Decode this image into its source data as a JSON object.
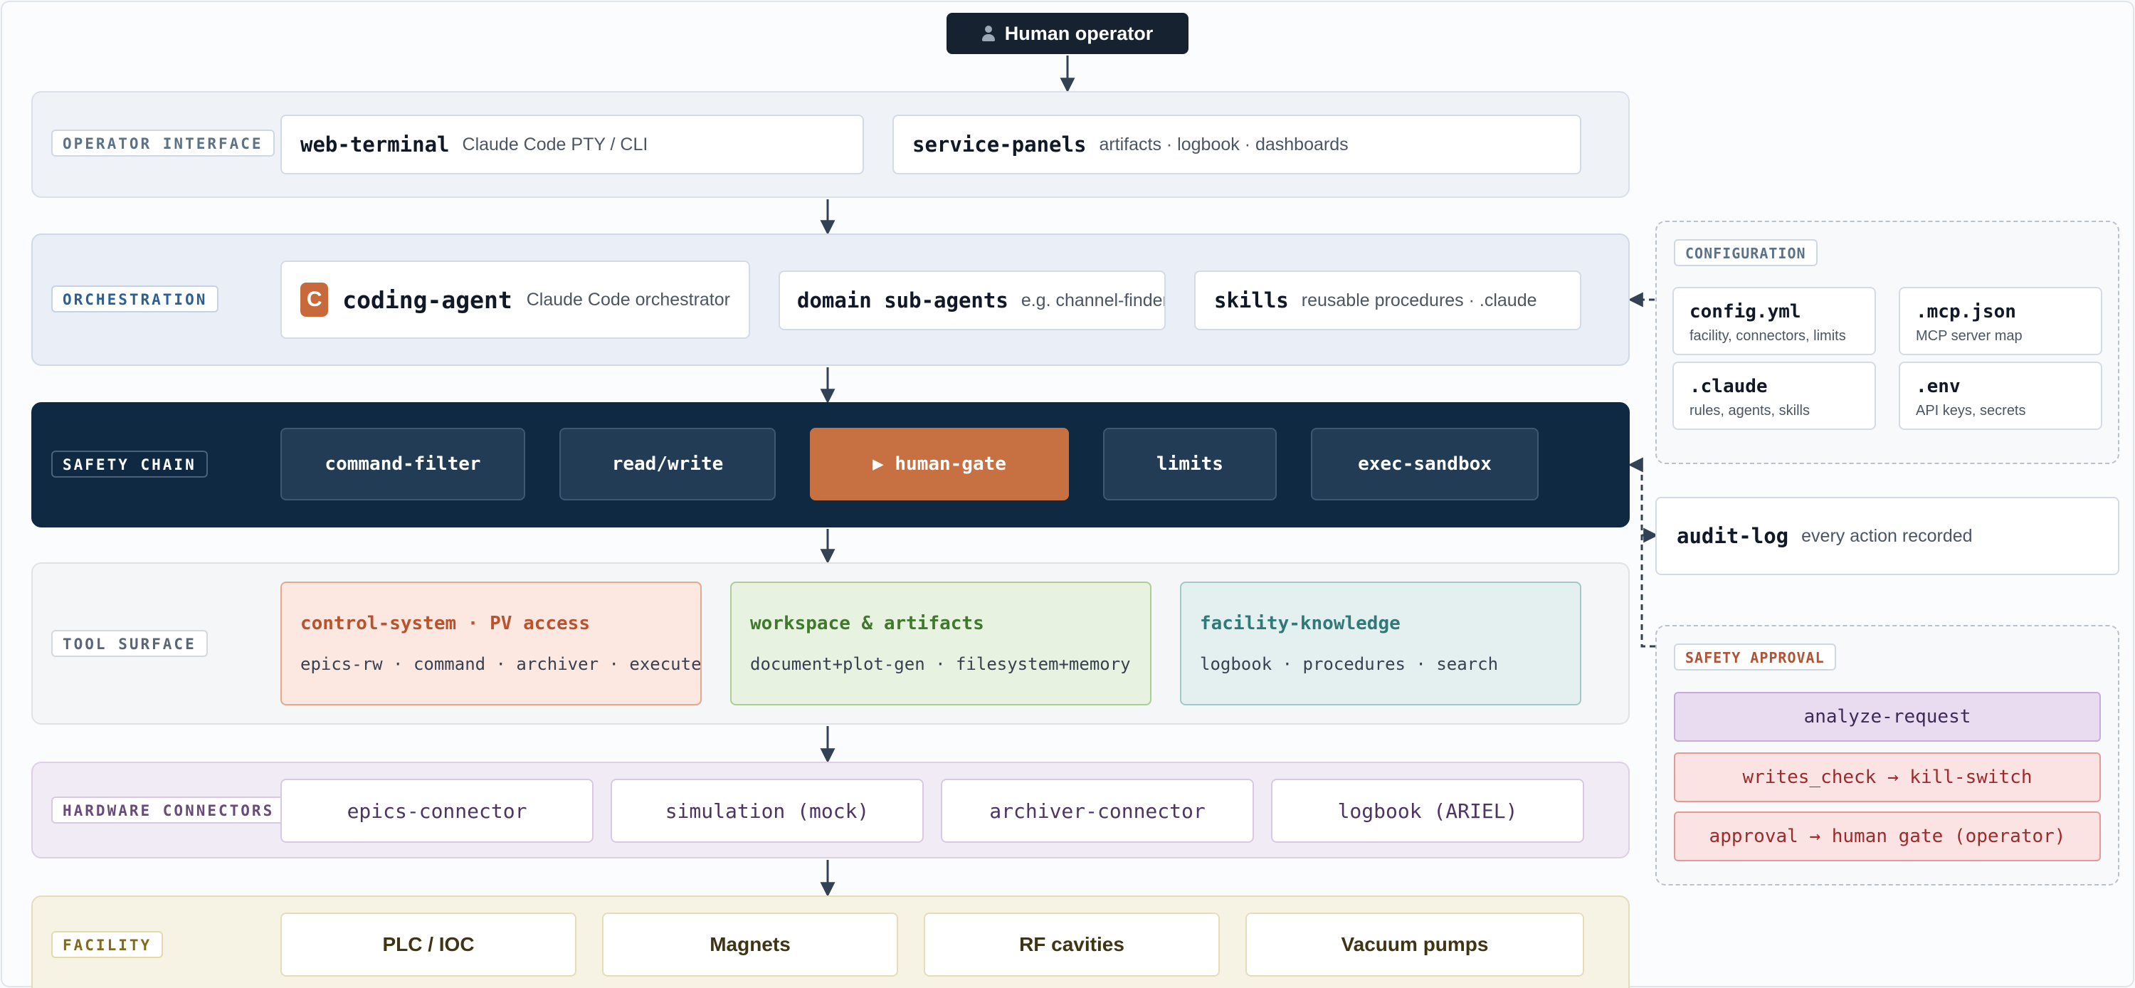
{
  "operator": {
    "label": "Human operator"
  },
  "layers": {
    "operator_interface": {
      "tag": "OPERATOR INTERFACE",
      "cards": [
        {
          "name": "web-terminal",
          "desc": "Claude Code PTY / CLI"
        },
        {
          "name": "service-panels",
          "desc": "artifacts · logbook · dashboards"
        }
      ]
    },
    "orchestration": {
      "tag": "ORCHESTRATION",
      "logo_letter": "C",
      "cards": [
        {
          "name": "coding-agent",
          "desc": "Claude Code orchestrator"
        },
        {
          "name": "domain sub-agents",
          "desc": "e.g. channel-finder"
        },
        {
          "name": "skills",
          "desc": "reusable procedures · .claude"
        }
      ]
    },
    "safety_chain": {
      "tag": "SAFETY CHAIN",
      "steps": [
        "command-filter",
        "read/write",
        "▶ human-gate",
        "limits",
        "exec-sandbox"
      ]
    },
    "tool_surface": {
      "tag": "TOOL SURFACE",
      "cards": [
        {
          "title": "control-system · PV access",
          "sub": "epics-rw · command · archiver · execute"
        },
        {
          "title": "workspace & artifacts",
          "sub": "document+plot-gen · filesystem+memory"
        },
        {
          "title": "facility-knowledge",
          "sub": "logbook · procedures · search"
        }
      ]
    },
    "hardware_connectors": {
      "tag": "HARDWARE CONNECTORS",
      "cards": [
        "epics-connector",
        "simulation (mock)",
        "archiver-connector",
        "logbook (ARIEL)"
      ]
    },
    "facility": {
      "tag": "FACILITY",
      "cards": [
        "PLC / IOC",
        "Magnets",
        "RF cavities",
        "Vacuum pumps"
      ]
    }
  },
  "configuration": {
    "tag": "CONFIGURATION",
    "files": [
      {
        "name": "config.yml",
        "desc": "facility, connectors, limits"
      },
      {
        "name": ".mcp.json",
        "desc": "MCP server map"
      },
      {
        "name": ".claude",
        "desc": "rules, agents, skills"
      },
      {
        "name": ".env",
        "desc": "API keys, secrets"
      }
    ]
  },
  "audit_log": {
    "name": "audit-log",
    "desc": "every action recorded"
  },
  "safety_approval": {
    "tag": "SAFETY APPROVAL",
    "items": [
      "analyze-request",
      "writes_check → kill-switch",
      "approval → human gate (operator)"
    ]
  },
  "colors": {
    "safety_band": "#0f2942",
    "human_gate": "#c77042",
    "control_system": "#b9532e",
    "workspace": "#3f7a2c",
    "facility_knowledge": "#2f7a78"
  }
}
